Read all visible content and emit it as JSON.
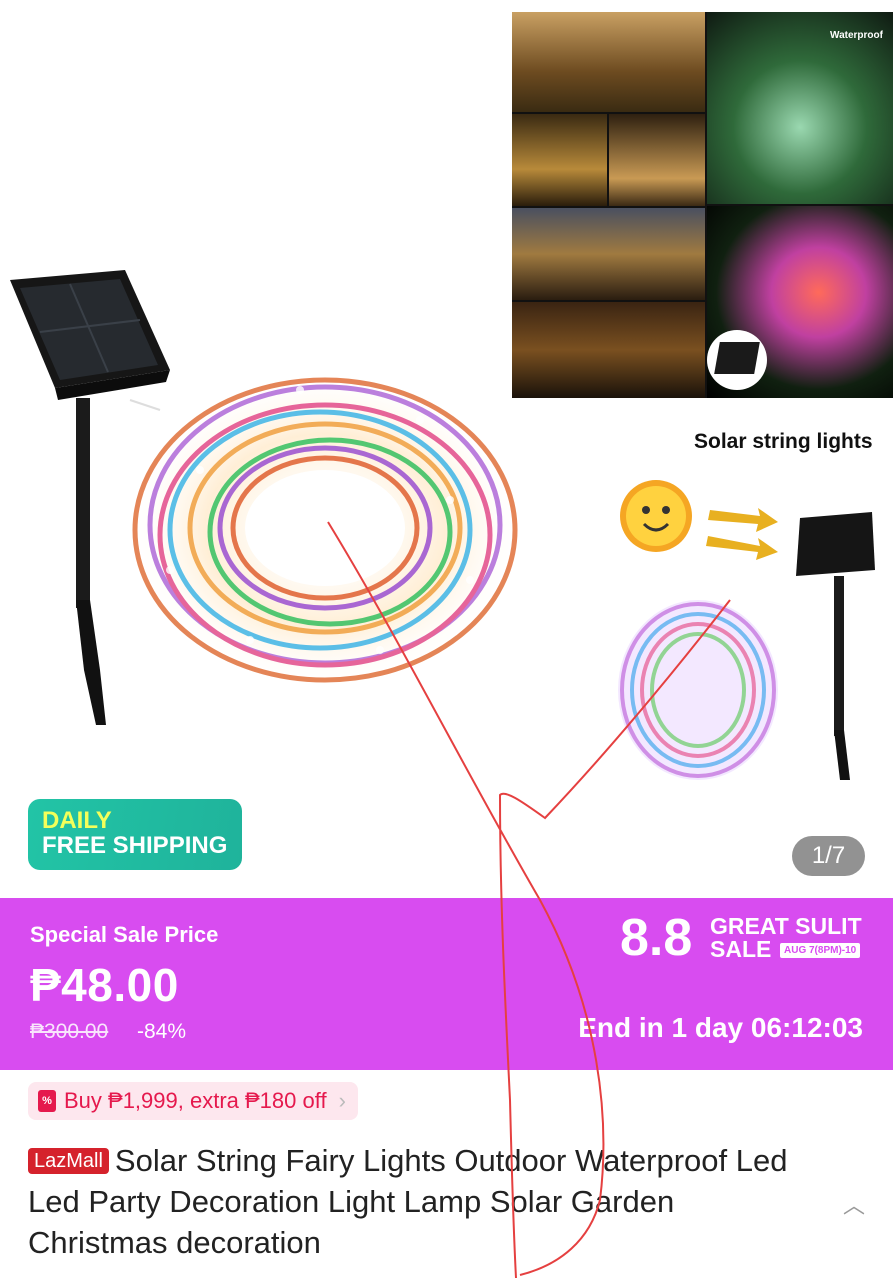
{
  "gallery": {
    "waterproof_label": "Waterproof",
    "solar_caption": "Solar string lights",
    "badge_line1": "DAILY",
    "badge_line2": "FREE SHIPPING",
    "counter": "1/7"
  },
  "promo": {
    "label": "Special Sale Price",
    "price": "₱48.00",
    "original_price": "₱300.00",
    "discount": "-84%",
    "campaign_number": "8.8",
    "campaign_line1": "GREAT SULIT",
    "campaign_line2": "SALE",
    "campaign_dates": "AUG 7(8PM)-10",
    "countdown": "End in 1 day 06:12:03",
    "bg_color": "#d84cf0"
  },
  "voucher": {
    "text": "Buy ₱1,999, extra ₱180 off",
    "icon": "%"
  },
  "product": {
    "badge": "LazMall",
    "title": "Solar String Fairy Lights Outdoor Waterproof Led Led Party Decoration Light Lamp Solar Garden Christmas decoration"
  }
}
